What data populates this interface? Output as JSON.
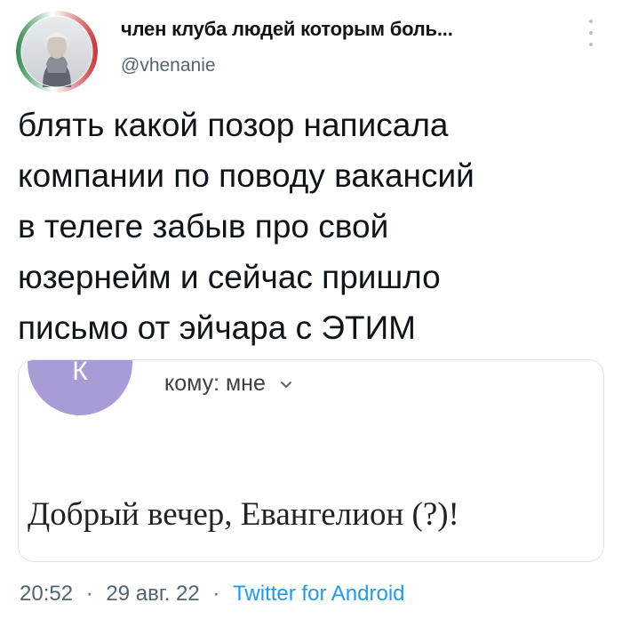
{
  "author": {
    "display_name": "член клуба людей которым боль...",
    "handle": "@vhenanie"
  },
  "tweet": {
    "text": "блять какой позор написала\nкомпании по поводу вакансий\nв телеге забыв про свой\nюзернейм и сейчас пришло\nписьмо от эйчара с ЭТИМ"
  },
  "media": {
    "sender_initial": "К",
    "recipient_label": "кому: мне",
    "greeting": "Добрый вечер, Евангелион (?)!"
  },
  "meta": {
    "time": "20:52",
    "separator": "·",
    "date": "29 авг. 22",
    "source": "Twitter for Android"
  },
  "colors": {
    "text": "#0f1419",
    "secondary": "#536471",
    "link": "#1d9bf0",
    "sender_avatar": "#a99bd6"
  },
  "icons": {
    "more": "more-vertical-icon",
    "chevron": "chevron-down-icon"
  }
}
